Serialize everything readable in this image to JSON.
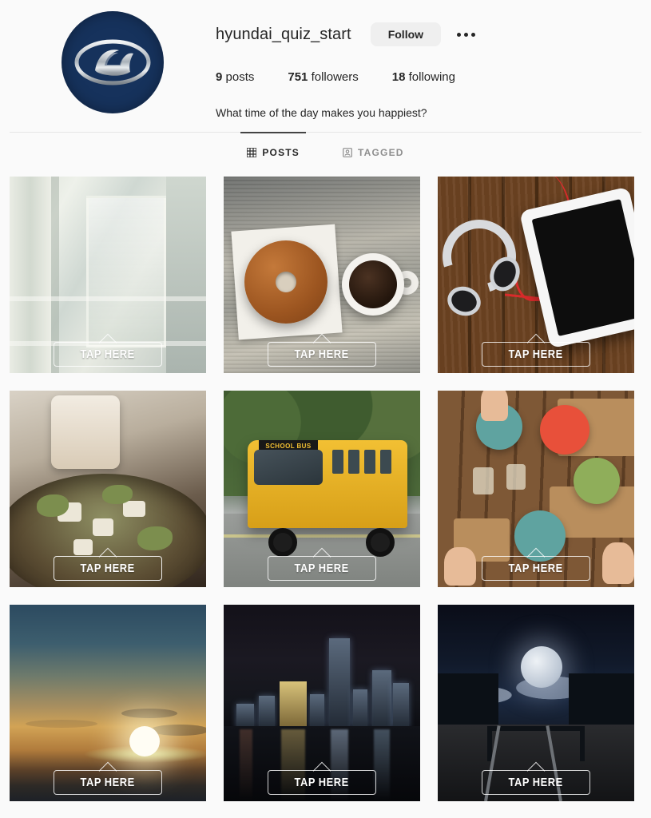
{
  "profile": {
    "username": "hyundai_quiz_start",
    "follow_label": "Follow",
    "options_icon": "more-options-icon",
    "avatar_icon": "hyundai-logo-avatar",
    "stats": [
      {
        "value": "9",
        "label": "posts"
      },
      {
        "value": "751",
        "label": "followers"
      },
      {
        "value": "18",
        "label": "following"
      }
    ],
    "bio": "What time of the day makes you happiest?"
  },
  "tabs": [
    {
      "label": "POSTS",
      "icon": "grid-icon",
      "active": true
    },
    {
      "label": "TAGGED",
      "icon": "tagged-person-icon",
      "active": false
    }
  ],
  "grid": {
    "tap_label": "TAP HERE",
    "posts": [
      {
        "alt": "window-curtain-daylight",
        "tap": "TAP HERE"
      },
      {
        "alt": "donut-and-coffee-on-wood",
        "tap": "TAP HERE",
        "sign": ""
      },
      {
        "alt": "headphones-and-tablet-on-wood",
        "tap": "TAP HERE"
      },
      {
        "alt": "salad-bowl-with-drink",
        "tap": "TAP HERE"
      },
      {
        "alt": "yellow-school-bus",
        "tap": "TAP HERE",
        "sign": "SCHOOL BUS"
      },
      {
        "alt": "shared-table-meal-overhead",
        "tap": "TAP HERE"
      },
      {
        "alt": "sunset-over-ocean",
        "tap": "TAP HERE"
      },
      {
        "alt": "city-skyline-at-night",
        "tap": "TAP HERE"
      },
      {
        "alt": "full-moon-over-railway",
        "tap": "TAP HERE"
      }
    ]
  },
  "colors": {
    "brand_navy": "#16325c",
    "text_primary": "#262626",
    "text_secondary": "#8e8e8e",
    "button_bg": "#efefef",
    "page_bg": "#fafafa"
  }
}
